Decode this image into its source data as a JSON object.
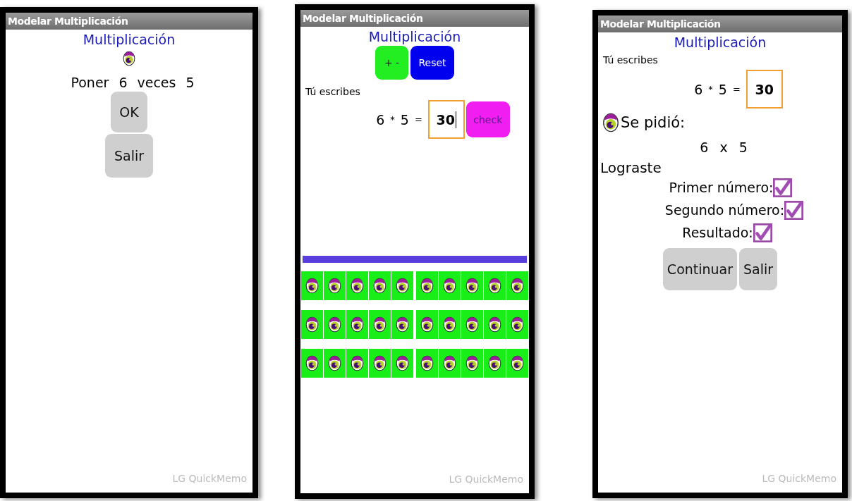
{
  "screens": [
    {
      "kind": "setup",
      "title_bar": "Modelar Multiplicación",
      "heading": "Multiplicación",
      "prompt": [
        "Poner",
        "6",
        "veces",
        "5"
      ],
      "buttons": [
        "OK",
        "Salir"
      ],
      "watermark": "LG QuickMemo"
    },
    {
      "kind": "practice",
      "title_bar": "Modelar Multiplicación",
      "heading": "Multiplicación",
      "tool_buttons": [
        {
          "label": "+ -",
          "color": "#22ee22"
        },
        {
          "label": "Reset",
          "color": "#0000ee"
        }
      ],
      "entry_label": "Tú escribes",
      "equation": [
        "6",
        "*",
        "5",
        "="
      ],
      "answer": "30",
      "check_button": "check",
      "watermark": "LG QuickMemo"
    },
    {
      "kind": "result",
      "title_bar": "Modelar Multiplicación",
      "heading": "Multiplicación",
      "entry_label": "Tú escribes",
      "equation": [
        "6",
        "*",
        "5",
        "="
      ],
      "answer": "30",
      "asked_label": "Se pidió:",
      "asked": [
        "6",
        "x",
        "5"
      ],
      "result_label": "Lograste",
      "checks": [
        {
          "label": "Primer número:",
          "checked": true
        },
        {
          "label": "Segundo número:",
          "checked": true
        },
        {
          "label": "Resultado:",
          "checked": true
        }
      ],
      "buttons": [
        "Continuar",
        "Salir"
      ],
      "watermark": "LG QuickMemo"
    }
  ]
}
